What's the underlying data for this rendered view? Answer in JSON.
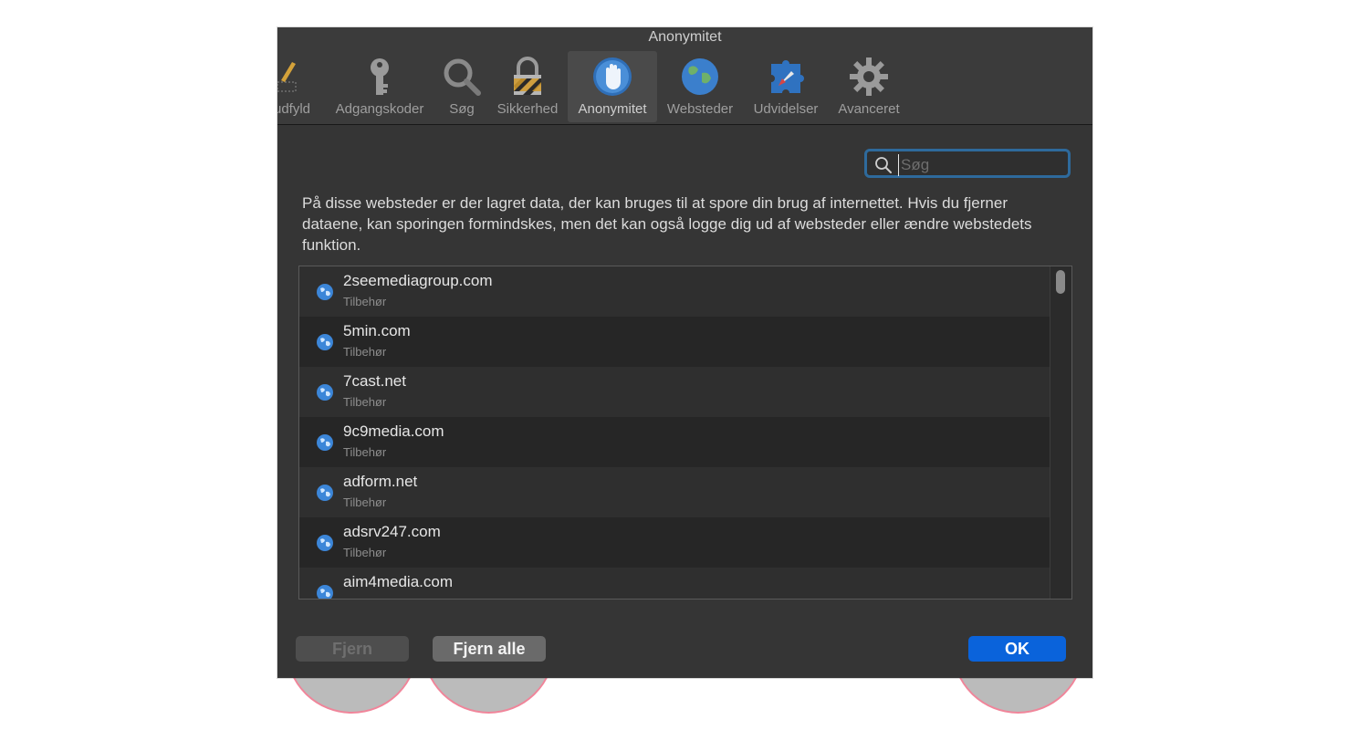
{
  "window": {
    "title": "Anonymitet"
  },
  "toolbar": {
    "items": [
      {
        "label": "udfyld",
        "icon": "pencil-icon"
      },
      {
        "label": "Adgangskoder",
        "icon": "key-icon"
      },
      {
        "label": "Søg",
        "icon": "magnifier-icon"
      },
      {
        "label": "Sikkerhed",
        "icon": "lock-icon"
      },
      {
        "label": "Anonymitet",
        "icon": "hand-icon",
        "active": true
      },
      {
        "label": "Websteder",
        "icon": "globe-icon"
      },
      {
        "label": "Udvidelser",
        "icon": "puzzle-icon"
      },
      {
        "label": "Avanceret",
        "icon": "gear-icon"
      }
    ]
  },
  "search": {
    "placeholder": "Søg",
    "value": ""
  },
  "description": "På disse websteder er der lagret data, der kan bruges til at spore din brug af internettet. Hvis du fjerner dataene, kan sporingen formindskes, men det kan også logge dig ud af websteder eller ændre webstedets funktion.",
  "sites": [
    {
      "domain": "2seemediagroup.com",
      "type": "Tilbehør"
    },
    {
      "domain": "5min.com",
      "type": "Tilbehør"
    },
    {
      "domain": "7cast.net",
      "type": "Tilbehør"
    },
    {
      "domain": "9c9media.com",
      "type": "Tilbehør"
    },
    {
      "domain": "adform.net",
      "type": "Tilbehør"
    },
    {
      "domain": "adsrv247.com",
      "type": "Tilbehør"
    },
    {
      "domain": "aim4media.com",
      "type": ""
    }
  ],
  "buttons": {
    "remove": "Fjern",
    "remove_all": "Fjern alle",
    "ok": "OK"
  },
  "colors": {
    "accent": "#0a63db",
    "highlight_ring": "#f0859a",
    "search_focus": "#2e6a9c"
  }
}
